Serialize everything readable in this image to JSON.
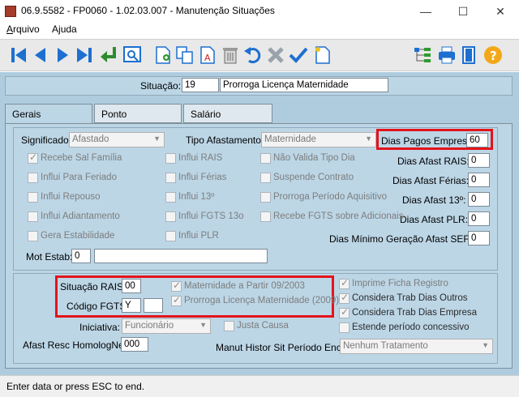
{
  "window": {
    "title": "06.9.5582 - FP0060 - 1.02.03.007 - Manutenção Situações",
    "minimize": "—",
    "maximize": "☐",
    "close": "✕"
  },
  "menu": {
    "arquivo": {
      "underline": "A",
      "rest": "rquivo"
    },
    "ajuda": {
      "pre": "A",
      "underline": "j",
      "rest": "uda"
    }
  },
  "toolbar": {
    "icons": [
      "first-record-icon",
      "previous-record-icon",
      "next-record-icon",
      "last-record-icon",
      "return-icon",
      "search-screen-icon",
      "new-document-icon",
      "copy-icon",
      "clear-field-icon",
      "delete-icon",
      "undo-icon",
      "cancel-icon",
      "confirm-icon",
      "blank-document-icon",
      "tree-icon",
      "print-icon",
      "exit-door-icon",
      "help-icon"
    ]
  },
  "situacao": {
    "label": "Situação:",
    "code": "19",
    "description": "Prorroga Licença Maternidade"
  },
  "tabs": [
    "Gerais",
    "Ponto",
    "Salário"
  ],
  "gerais": {
    "significado_label": "Significado:",
    "significado_value": "Afastado",
    "tipo_afastamento_label": "Tipo Afastamento:",
    "tipo_afastamento_value": "Maternidade",
    "dias_pagos_label": "Dias Pagos Empresa:",
    "dias_pagos_value": "60",
    "dias_rais_label": "Dias Afast RAIS:",
    "dias_rais_value": "0",
    "dias_ferias_label": "Dias Afast Férias:",
    "dias_ferias_value": "0",
    "dias_13_label": "Dias Afast 13º:",
    "dias_13_value": "0",
    "dias_plr_label": "Dias Afast PLR:",
    "dias_plr_value": "0",
    "dias_sefip_label": "Dias Mínimo Geração Afast SEFIP:",
    "dias_sefip_value": "0",
    "checkboxes_col1": [
      {
        "label": "Recebe Sal Família",
        "checked": true
      },
      {
        "label": "Influi Para Feriado",
        "checked": false
      },
      {
        "label": "Influi Repouso",
        "checked": false
      },
      {
        "label": "Influi Adiantamento",
        "checked": false
      },
      {
        "label": "Gera Estabilidade",
        "checked": false
      }
    ],
    "checkboxes_col2": [
      {
        "label": "Influi RAIS",
        "checked": false
      },
      {
        "label": "Influi Férias",
        "checked": false
      },
      {
        "label": "Influi 13º",
        "checked": false
      },
      {
        "label": "Influi FGTS 13o",
        "checked": false
      },
      {
        "label": "Influi PLR",
        "checked": false
      }
    ],
    "checkboxes_col3": [
      {
        "label": "Não Valida Tipo Dia",
        "checked": false
      },
      {
        "label": "Suspende Contrato",
        "checked": false
      },
      {
        "label": "Prorroga Período Aquisitivo",
        "checked": false
      },
      {
        "label": "Recebe FGTS sobre Adicionais",
        "checked": false
      }
    ],
    "mot_estab_label": "Mot Estab:",
    "mot_estab_value": "0",
    "mot_estab_desc": ""
  },
  "lower": {
    "situacao_rais_label": "Situação RAIS:",
    "situacao_rais_value": "00",
    "codigo_fgts_label": "Código FGTS:",
    "codigo_fgts_value": "Y",
    "codigo_fgts_extra": "",
    "maternidade_0903": {
      "label": "Maternidade a Partir 09/2003",
      "checked": true
    },
    "prorroga_2009": {
      "label": "Prorroga Licença Maternidade (2009)",
      "checked": true
    },
    "imprime_ficha": {
      "label": "Imprime Ficha Registro",
      "checked": true
    },
    "considera_outros": {
      "label": "Considera Trab Dias Outros",
      "checked": true
    },
    "considera_empresa": {
      "label": "Considera Trab Dias Empresa",
      "checked": true
    },
    "estende_periodo": {
      "label": "Estende período concessivo",
      "checked": false
    },
    "iniciativa_label": "Iniciativa:",
    "iniciativa_value": "Funcionário",
    "justa_causa": {
      "label": "Justa Causa",
      "checked": false
    },
    "afast_resc_label": "Afast Resc HomologNet:",
    "afast_resc_value": "000",
    "manut_histor_label": "Manut Histor Sit Período Encer:",
    "manut_histor_value": "Nenhum Tratamento"
  },
  "status": {
    "text": "Enter data or press ESC to end."
  },
  "colors": {
    "panel": "#aeccde",
    "highlight": "#e3141b",
    "toolbar_blue": "#1d6fd0"
  }
}
